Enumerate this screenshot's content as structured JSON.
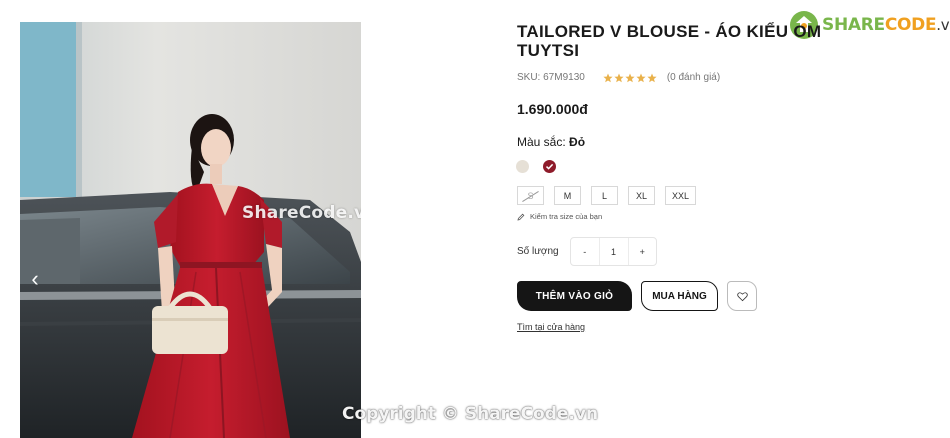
{
  "watermark": {
    "logo_text_a": "SHARE",
    "logo_text_b": "CODE",
    "logo_text_c": ".vn",
    "image_mark": "ShareCode.vn",
    "copyright": "Copyright © ShareCode.vn"
  },
  "gallery": {
    "prev_icon": "chevron-left-icon",
    "prev_glyph": "‹"
  },
  "product": {
    "title": "TAILORED V BLOUSE - ÁO KIỂU OM TUYTSI",
    "sku": "SKU: 67M9130",
    "rating": 5,
    "reviews": "(0 đánh giá)",
    "price": "1.690.000đ",
    "color_label": "Màu sắc:",
    "color_value": "Đỏ",
    "colors": [
      {
        "name": "beige",
        "hex": "#e6e0d6",
        "selected": false
      },
      {
        "name": "red",
        "hex": "#8e1b2a",
        "selected": true
      }
    ],
    "sizes": [
      {
        "label": "S",
        "available": false
      },
      {
        "label": "M",
        "available": true
      },
      {
        "label": "L",
        "available": true
      },
      {
        "label": "XL",
        "available": true
      },
      {
        "label": "XXL",
        "available": true
      }
    ],
    "size_guide": "Kiểm tra size của bạn",
    "quantity_label": "Số lượng",
    "quantity_minus": "-",
    "quantity_value": "1",
    "quantity_plus": "+",
    "add_to_cart": "THÊM VÀO GIỎ",
    "buy_now": "MUA HÀNG",
    "find_store": "Tìm tại cửa hàng"
  },
  "colors": {
    "star": "#e9b14b",
    "button_dark": "#151515",
    "dress_red": "#b8192b"
  }
}
